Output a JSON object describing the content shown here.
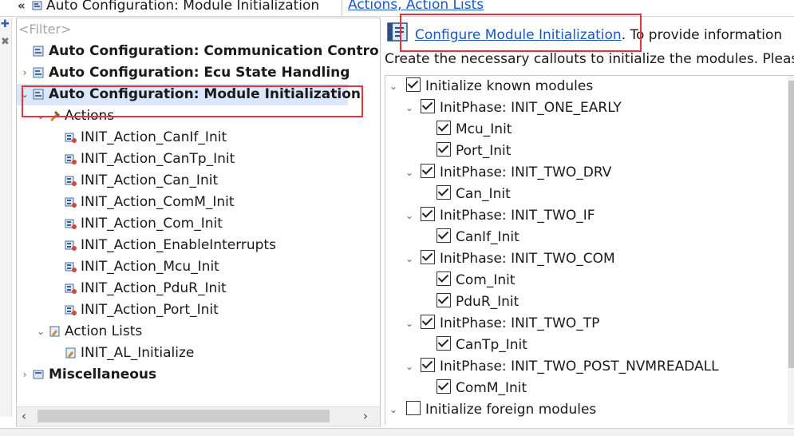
{
  "header": {
    "left_title": "Auto Configuration: Module Initialization",
    "breadcrumb": "Actions, Action Lists"
  },
  "left_tree": {
    "filter_placeholder": "<Filter>",
    "items": [
      {
        "label": "Auto Configuration: Communication Control"
      },
      {
        "label": "Auto Configuration: Ecu State Handling"
      },
      {
        "label": "Auto Configuration: Module Initialization"
      },
      {
        "label": "Actions"
      },
      {
        "label": "INIT_Action_CanIf_Init"
      },
      {
        "label": "INIT_Action_CanTp_Init"
      },
      {
        "label": "INIT_Action_Can_Init"
      },
      {
        "label": "INIT_Action_ComM_Init"
      },
      {
        "label": "INIT_Action_Com_Init"
      },
      {
        "label": "INIT_Action_EnableInterrupts"
      },
      {
        "label": "INIT_Action_Mcu_Init"
      },
      {
        "label": "INIT_Action_PduR_Init"
      },
      {
        "label": "INIT_Action_Port_Init"
      },
      {
        "label": "Action Lists"
      },
      {
        "label": "INIT_AL_Initialize"
      },
      {
        "label": "Miscellaneous"
      }
    ]
  },
  "right": {
    "link_text": "Configure Module Initialization",
    "desc_rest": ". To provide information",
    "desc_line2": "Create the necessary callouts to initialize the modules. Pleas",
    "items": [
      {
        "label": "Initialize known modules"
      },
      {
        "label": "InitPhase: INIT_ONE_EARLY"
      },
      {
        "label": "Mcu_Init"
      },
      {
        "label": "Port_Init"
      },
      {
        "label": "InitPhase: INIT_TWO_DRV"
      },
      {
        "label": "Can_Init"
      },
      {
        "label": "InitPhase: INIT_TWO_IF"
      },
      {
        "label": "CanIf_Init"
      },
      {
        "label": "InitPhase: INIT_TWO_COM"
      },
      {
        "label": "Com_Init"
      },
      {
        "label": "PduR_Init"
      },
      {
        "label": "InitPhase: INIT_TWO_TP"
      },
      {
        "label": "CanTp_Init"
      },
      {
        "label": "InitPhase: INIT_TWO_POST_NVMREADALL"
      },
      {
        "label": "ComM_Init"
      },
      {
        "label": "Initialize foreign modules"
      }
    ]
  },
  "colors": {
    "highlight": "#e8333a",
    "link": "#1a56c4"
  }
}
